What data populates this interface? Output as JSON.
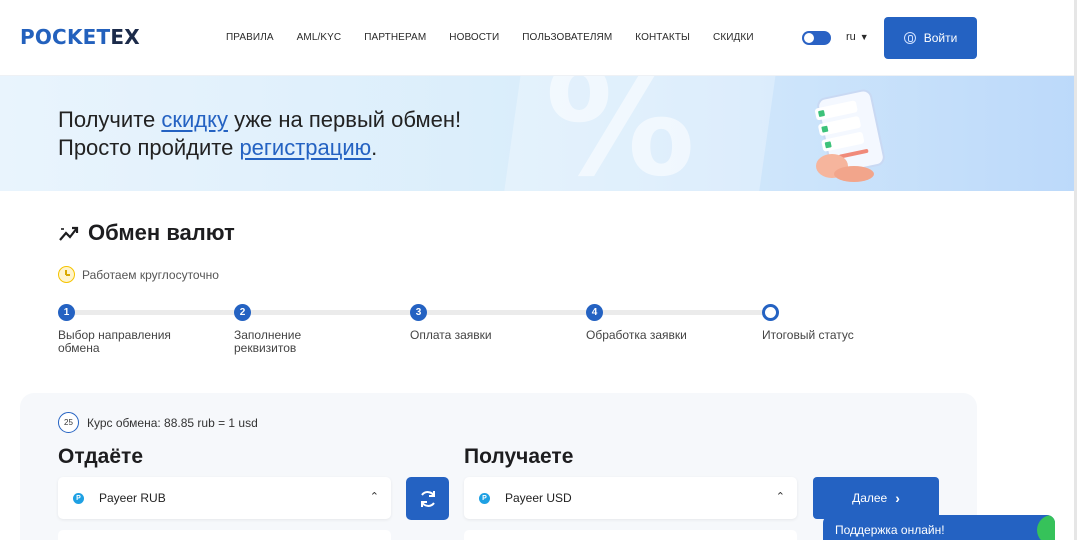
{
  "header": {
    "logo_part1": "POCKET",
    "logo_part2": "EX",
    "nav": [
      "ПРАВИЛА",
      "AML/KYC",
      "ПАРТНЕРАМ",
      "НОВОСТИ",
      "ПОЛЬЗОВАТЕЛЯМ",
      "КОНТАКТЫ",
      "СКИДКИ"
    ],
    "lang": "ru",
    "login_label": "Войти"
  },
  "banner": {
    "line1_pre": "Получите ",
    "line1_link": "скидку",
    "line1_post": " уже на первый обмен!",
    "line2_pre": "Просто пройдите ",
    "line2_link": "регистрацию",
    "line2_post": ".",
    "percent_glyph": "%"
  },
  "exchange": {
    "title": "Обмен валют",
    "hours": "Работаем круглосуточно",
    "steps": [
      {
        "num": "1",
        "label_line1": "Выбор направления",
        "label_line2": "обмена"
      },
      {
        "num": "2",
        "label_line1": "Заполнение",
        "label_line2": "реквизитов"
      },
      {
        "num": "3",
        "label_line1": "Оплата заявки",
        "label_line2": ""
      },
      {
        "num": "4",
        "label_line1": "Обработка заявки",
        "label_line2": ""
      },
      {
        "num": "",
        "label_line1": "Итоговый статус",
        "label_line2": ""
      }
    ],
    "timer": "25",
    "rate": "Курс обмена: 88.85 rub = 1 usd",
    "give_title": "Отдаёте",
    "get_title": "Получаете",
    "give_currency": "Payeer RUB",
    "get_currency": "Payeer USD",
    "next_label": "Далее",
    "payeer_glyph": "P"
  },
  "support": {
    "label": "Поддержка онлайн!"
  },
  "colors": {
    "accent": "#2462c2",
    "yellow": "#f5c400",
    "green": "#36c25a"
  }
}
